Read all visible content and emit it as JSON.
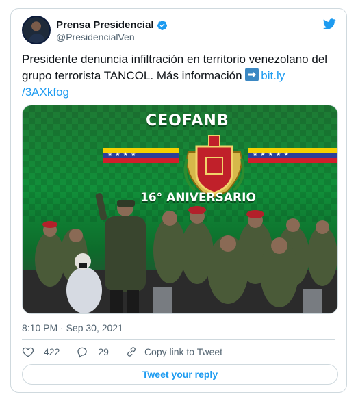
{
  "author": {
    "display_name": "Prensa Presidencial",
    "handle": "@PresidencialVen",
    "verified": true
  },
  "tweet": {
    "text_main": "Presidente denuncia infiltración en territorio venezolano del grupo terrorista TANCOL. Más información",
    "link_text": "bit.ly/3AXkfog",
    "link_line1": "bit.ly",
    "link_line2": "/3AXkfog",
    "timestamp": "8:10 PM · Sep 30, 2021"
  },
  "media": {
    "banner_title": "CEOFANB",
    "anniversary_text": "16° ANIVERSARIO"
  },
  "stats": {
    "likes": "422",
    "replies": "29",
    "copy_link_label": "Copy link to Tweet"
  },
  "reply_button_label": "Tweet your reply",
  "colors": {
    "accent": "#1d9bf0",
    "text_primary": "#0f1419",
    "text_secondary": "#536471",
    "border": "#cfd9de",
    "banner_green": "#11903a"
  },
  "icons": [
    "avatar",
    "verified-badge-icon",
    "twitter-bird-icon",
    "arrow-right-emoji-icon",
    "heart-icon",
    "reply-icon",
    "link-icon"
  ]
}
